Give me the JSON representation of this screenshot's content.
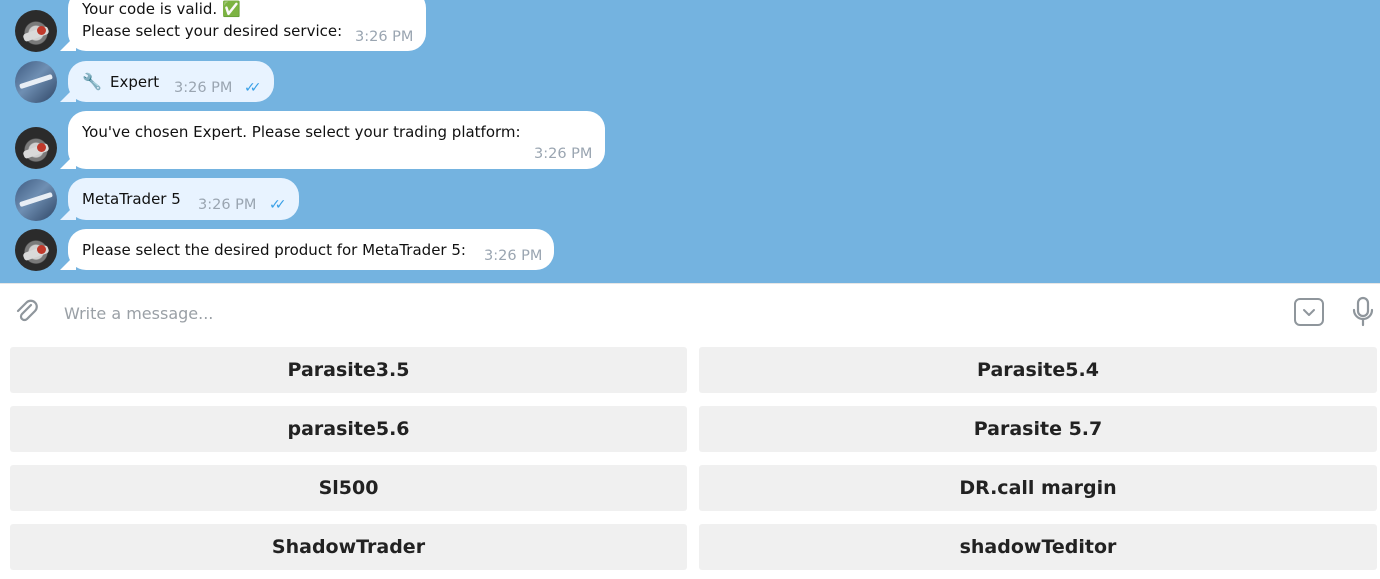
{
  "messages": [
    {
      "sender": "bot",
      "lines": [
        "Your code is valid. ✅",
        "Please select your desired service:"
      ],
      "time": "3:26 PM"
    },
    {
      "sender": "user",
      "icon": "🔧",
      "text": "Expert",
      "time": "3:26 PM",
      "checks": "✓✓"
    },
    {
      "sender": "bot",
      "lines": [
        "You've chosen Expert. Please select your trading platform:"
      ],
      "time": "3:26 PM"
    },
    {
      "sender": "user",
      "text": "MetaTrader 5",
      "time": "3:26 PM",
      "checks": "✓✓"
    },
    {
      "sender": "bot",
      "lines": [
        "Please select the desired product for MetaTrader 5:"
      ],
      "time": "3:26 PM"
    }
  ],
  "composer": {
    "placeholder": "Write a message..."
  },
  "keyboard": {
    "buttons": [
      "Parasite3.5",
      "Parasite5.4",
      "parasite5.6",
      "Parasite 5.7",
      "Sl500",
      "DR.call margin",
      "ShadowTrader",
      "shadowTeditor"
    ]
  },
  "colors": {
    "chat_bg": "#74b3e0",
    "incoming": "#ffffff",
    "outgoing": "#e8f3ff",
    "time": "#9aa5b1",
    "check": "#3aa0e6",
    "key_bg": "#f0f0f0"
  },
  "icons": {
    "attach": "paperclip-icon",
    "keyboard": "keyboard-toggle-icon",
    "mic": "microphone-icon",
    "tick": "double-check-icon"
  }
}
